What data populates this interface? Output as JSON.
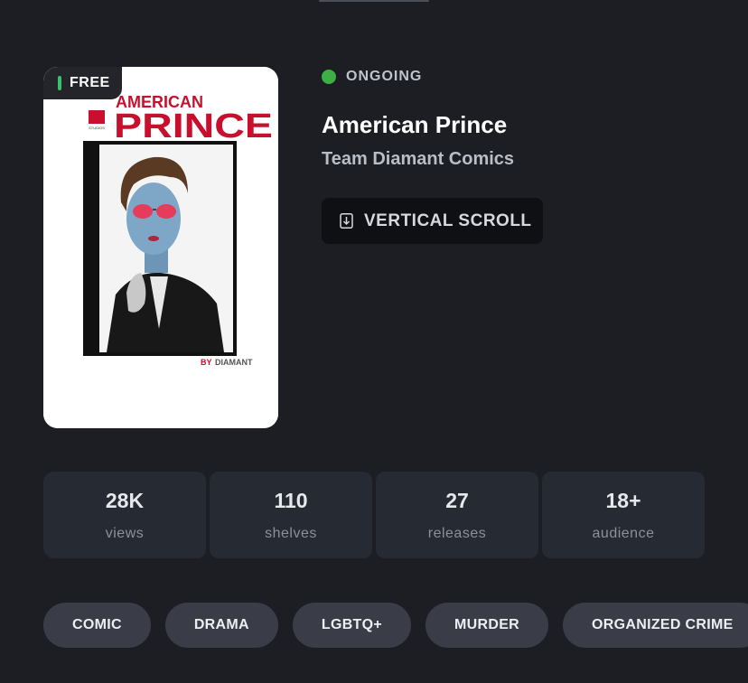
{
  "cover": {
    "badge": "FREE",
    "art": {
      "title_top": "AMERICAN",
      "title_main": "PRINCE",
      "studio": "STUDIOS",
      "byline_by": "BY",
      "byline_name": "DIAMANT"
    }
  },
  "series": {
    "status": "ONGOING",
    "title": "American Prince",
    "author": "Team Diamant Comics",
    "read_mode": "VERTICAL SCROLL"
  },
  "stats": [
    {
      "value": "28K",
      "label": "views"
    },
    {
      "value": "110",
      "label": "shelves"
    },
    {
      "value": "27",
      "label": "releases"
    },
    {
      "value": "18+",
      "label": "audience"
    }
  ],
  "tags": [
    "COMIC",
    "DRAMA",
    "LGBTQ+",
    "MURDER",
    "ORGANIZED CRIME"
  ],
  "colors": {
    "background": "#1c1e23",
    "status_ongoing": "#3cb043",
    "free_badge_accent": "#39c16b",
    "cover_title_red": "#c8102e"
  }
}
